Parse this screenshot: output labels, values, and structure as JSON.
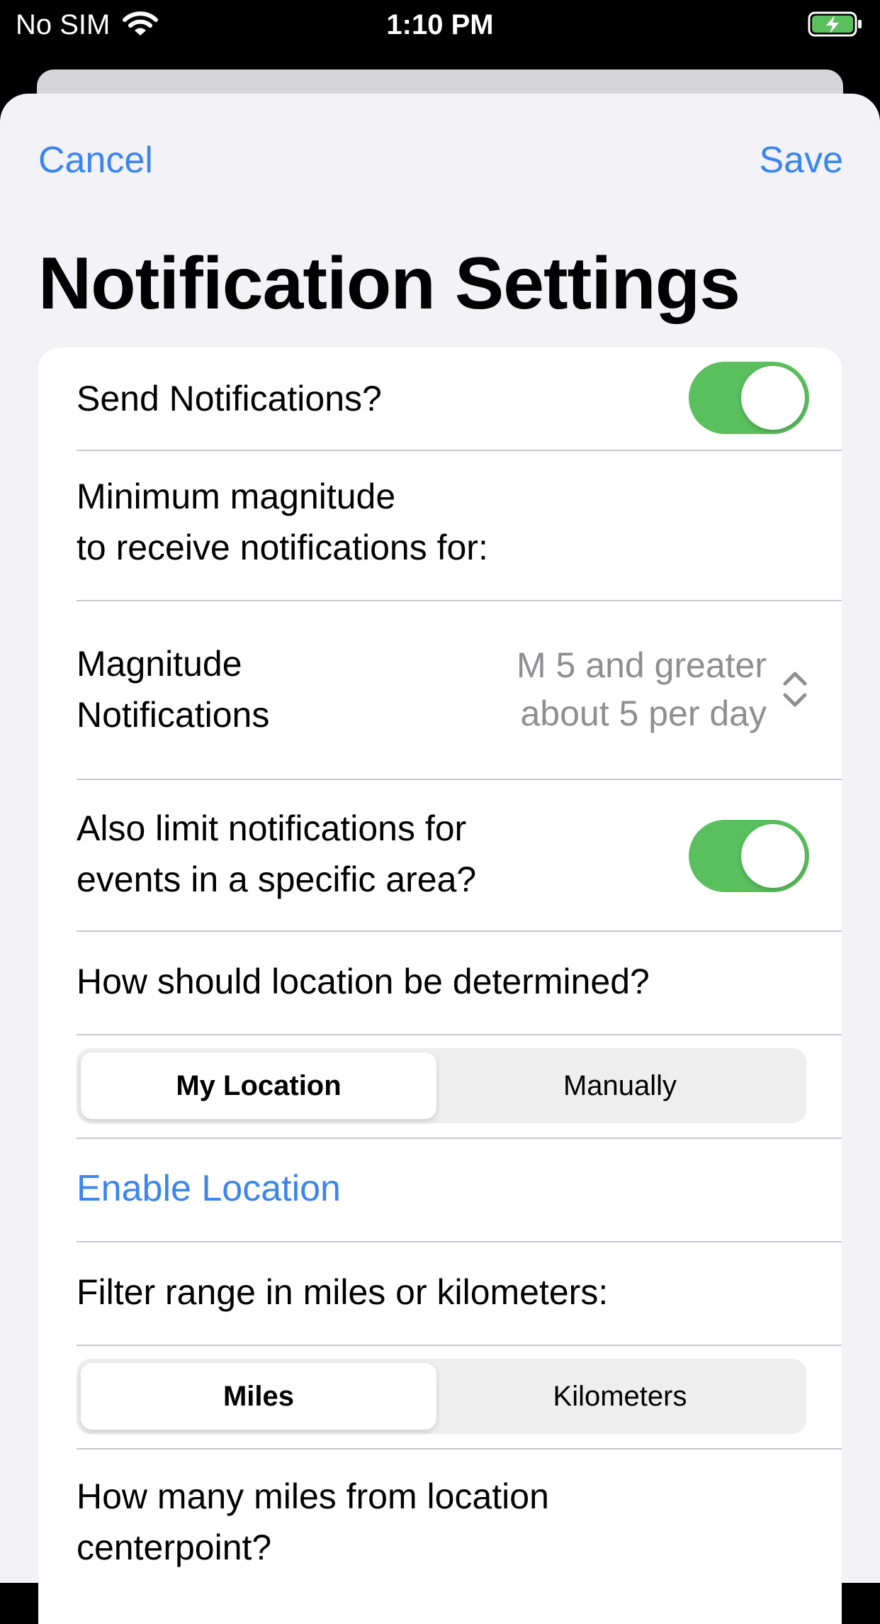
{
  "status_bar": {
    "carrier": "No SIM",
    "time": "1:10 PM",
    "icons": [
      "wifi-icon",
      "battery-charging-icon"
    ]
  },
  "nav": {
    "cancel_label": "Cancel",
    "save_label": "Save"
  },
  "page": {
    "title": "Notification Settings"
  },
  "settings": {
    "send_notifications": {
      "label": "Send Notifications?",
      "on": true
    },
    "min_magnitude_heading": {
      "line1": "Minimum magnitude",
      "line2": "to receive notifications for:"
    },
    "magnitude_picker": {
      "label_line1": "Magnitude",
      "label_line2": "Notifications",
      "value_line1": "M 5 and greater",
      "value_line2": "about 5 per day"
    },
    "limit_area": {
      "label_line1": "Also limit notifications for",
      "label_line2": "events in a specific area?",
      "on": true
    },
    "location_question": "How should location be determined?",
    "location_segment": {
      "options": [
        "My Location",
        "Manually"
      ],
      "selected": "My Location"
    },
    "enable_location_label": "Enable Location",
    "range_question": "Filter range in miles or kilometers:",
    "unit_segment": {
      "options": [
        "Miles",
        "Kilometers"
      ],
      "selected": "Miles"
    },
    "distance_question": {
      "line1": "How many miles from location",
      "line2": "centerpoint?"
    }
  },
  "colors": {
    "accent": "#3a85f0",
    "toggle_on": "#5ac05e",
    "background": "#f2f2f7",
    "secondary_text": "#8e8e93"
  }
}
